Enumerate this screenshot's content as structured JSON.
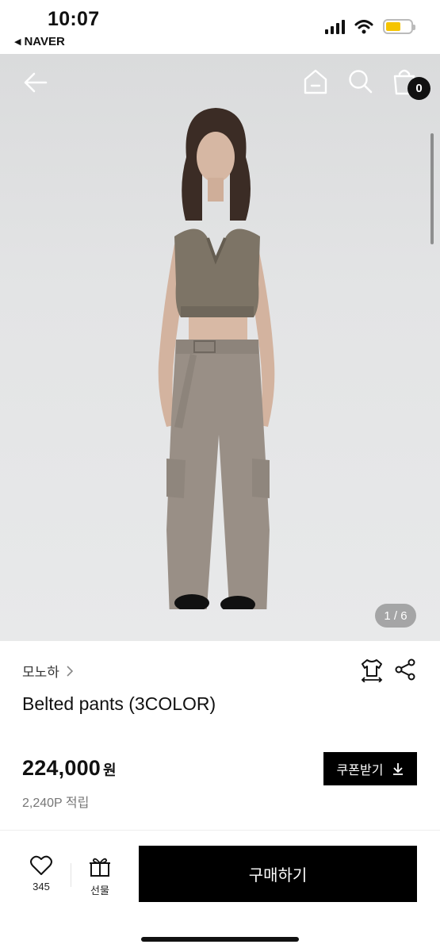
{
  "status_bar": {
    "time": "10:07",
    "back_app": "NAVER",
    "back_icon": "back-triangle-icon",
    "battery_color": "#f5c400"
  },
  "header": {
    "icons": [
      "back-arrow-icon",
      "home-icon",
      "search-icon",
      "shopping-bag-icon"
    ],
    "cart_count": "0"
  },
  "gallery": {
    "indicator": "1 / 6"
  },
  "product": {
    "brand": "모노하",
    "title": "Belted pants (3COLOR)",
    "price": "224,000",
    "currency": "원",
    "points": "2,240P 적립",
    "coupon_label": "쿠폰받기"
  },
  "bottom_bar": {
    "like_count": "345",
    "gift_label": "선물",
    "buy_label": "구매하기"
  },
  "colors": {
    "primary_button": "#000000",
    "hero_background": "#e3e4e5"
  }
}
